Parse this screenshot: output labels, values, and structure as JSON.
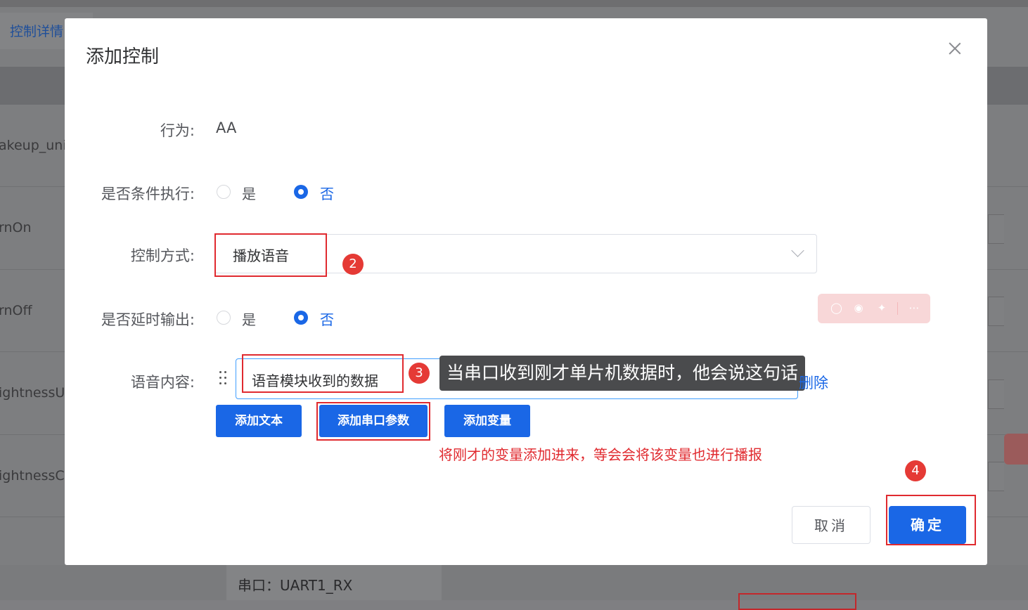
{
  "background": {
    "tab_label": "控制详情",
    "row_labels": [
      "akeup_uni",
      "rnOn",
      "rnOff",
      "ightnessU",
      "ightnessC"
    ],
    "port_label": "串口：UART1_RX"
  },
  "dialog": {
    "title": "添加控制",
    "close_icon": "close-icon",
    "behavior": {
      "label": "行为:",
      "value": "AA"
    },
    "conditional": {
      "label": "是否条件执行:",
      "options": [
        "是",
        "否"
      ],
      "selected": "否"
    },
    "control_mode": {
      "label": "控制方式:",
      "value": "播放语音"
    },
    "delay_output": {
      "label": "是否延时输出:",
      "options": [
        "是",
        "否"
      ],
      "selected": "否"
    },
    "voice": {
      "label": "语音内容:",
      "value": "语音模块收到的数据",
      "delete_label": "删除",
      "tooltip": "当串口收到刚才单片机数据时，他会说这句话"
    },
    "add_buttons": {
      "text": "添加文本",
      "serial_param": "添加串口参数",
      "variable": "添加变量"
    },
    "annotation": "将刚才的变量添加进来，等会会将该变量也进行播报",
    "cancel_label": "取消",
    "ok_label": "确定",
    "badges": [
      "2",
      "3",
      "4"
    ]
  },
  "toolbar_icons": [
    "search-icon",
    "chat-icon",
    "magic-icon",
    "more-icon"
  ],
  "colors": {
    "primary": "#1a67e6",
    "annotation_red": "#e02a2f",
    "badge_red": "#e53a35"
  }
}
